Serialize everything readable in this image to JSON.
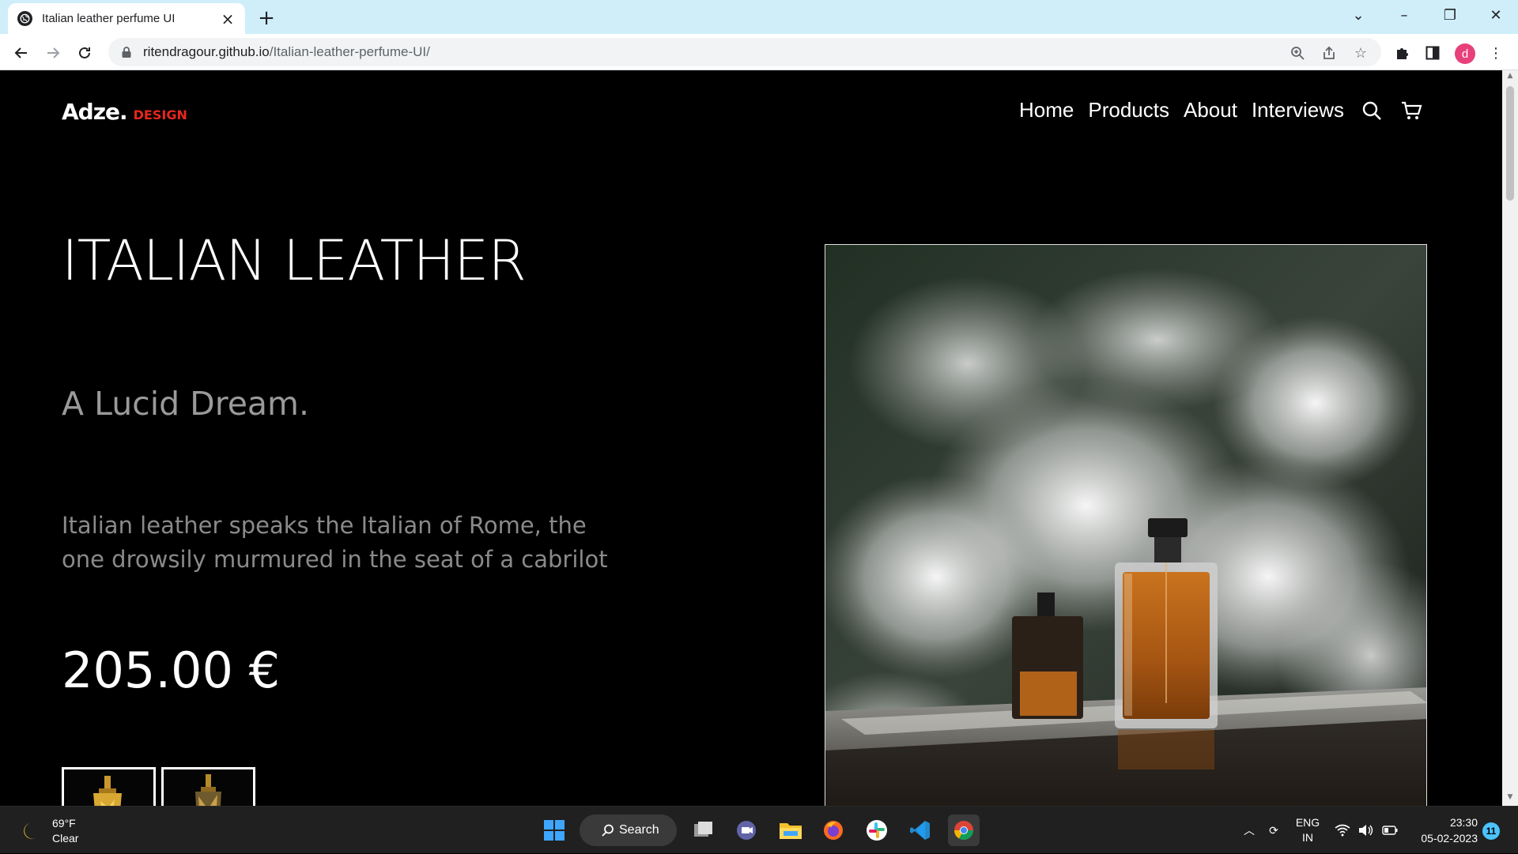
{
  "browser": {
    "tab_title": "Italian leather perfume UI",
    "url_host": "ritendragour.github.io",
    "url_path": "/Italian-leather-perfume-UI/",
    "profile_initial": "d"
  },
  "site": {
    "logo_main": "Adze.",
    "logo_sub": "DESIGN",
    "nav": [
      "Home",
      "Products",
      "About",
      "Interviews"
    ],
    "title": "ITALIAN LEATHER",
    "subtitle": "A Lucid Dream.",
    "description": "Italian leather speaks the Italian of Rome, the one drowsily murmured in the seat of a cabrilot",
    "price": "205.00 €",
    "accent_color": "#e8271b"
  },
  "taskbar": {
    "temperature": "69°F",
    "condition": "Clear",
    "search_label": "Search",
    "lang_top": "ENG",
    "lang_bottom": "IN",
    "time": "23:30",
    "date": "05-02-2023",
    "notification_count": "11"
  }
}
